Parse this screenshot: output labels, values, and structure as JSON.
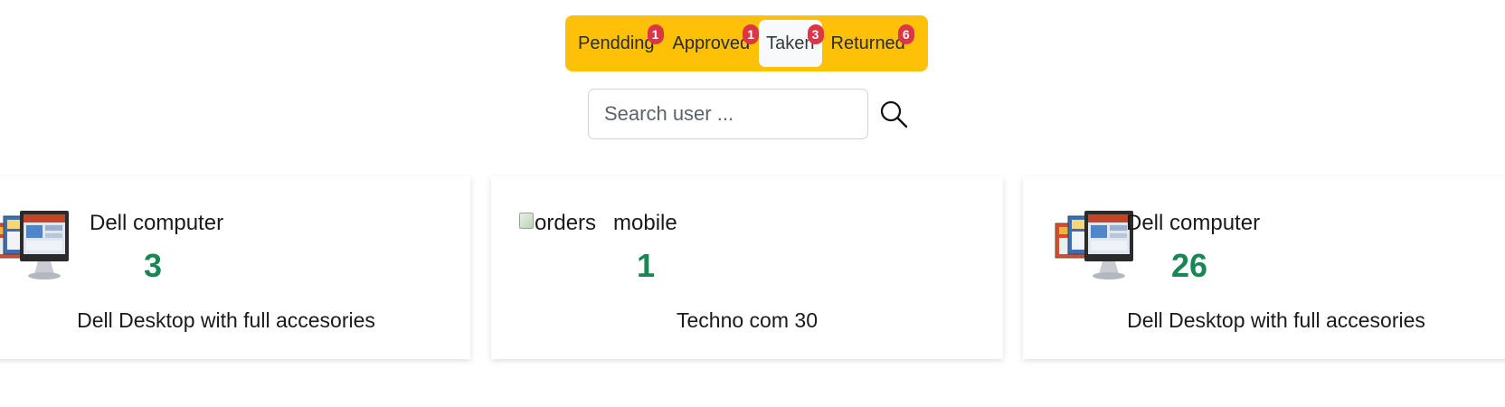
{
  "tabs": [
    {
      "label": "Pendding",
      "badge": "1",
      "active": false
    },
    {
      "label": "Approved",
      "badge": "1",
      "active": false
    },
    {
      "label": "Taken",
      "badge": "3",
      "active": true
    },
    {
      "label": "Returned",
      "badge": "6",
      "active": false
    }
  ],
  "search": {
    "placeholder": "Search user ...",
    "value": ""
  },
  "cards": [
    {
      "name": "Dell computer",
      "count": "3",
      "description": "Dell Desktop with full accesories",
      "image": "desktop-monitors"
    },
    {
      "name": "mobile",
      "count": "1",
      "description": "Techno com 30",
      "image_alt": "orders"
    },
    {
      "name": "Dell computer",
      "count": "26",
      "description": "Dell Desktop with full accesories",
      "image": "desktop-monitors"
    }
  ],
  "colors": {
    "tab_bar": "#ffc107",
    "badge": "#dc3545",
    "count": "#198754",
    "active_tab": "#f8f9fa"
  }
}
